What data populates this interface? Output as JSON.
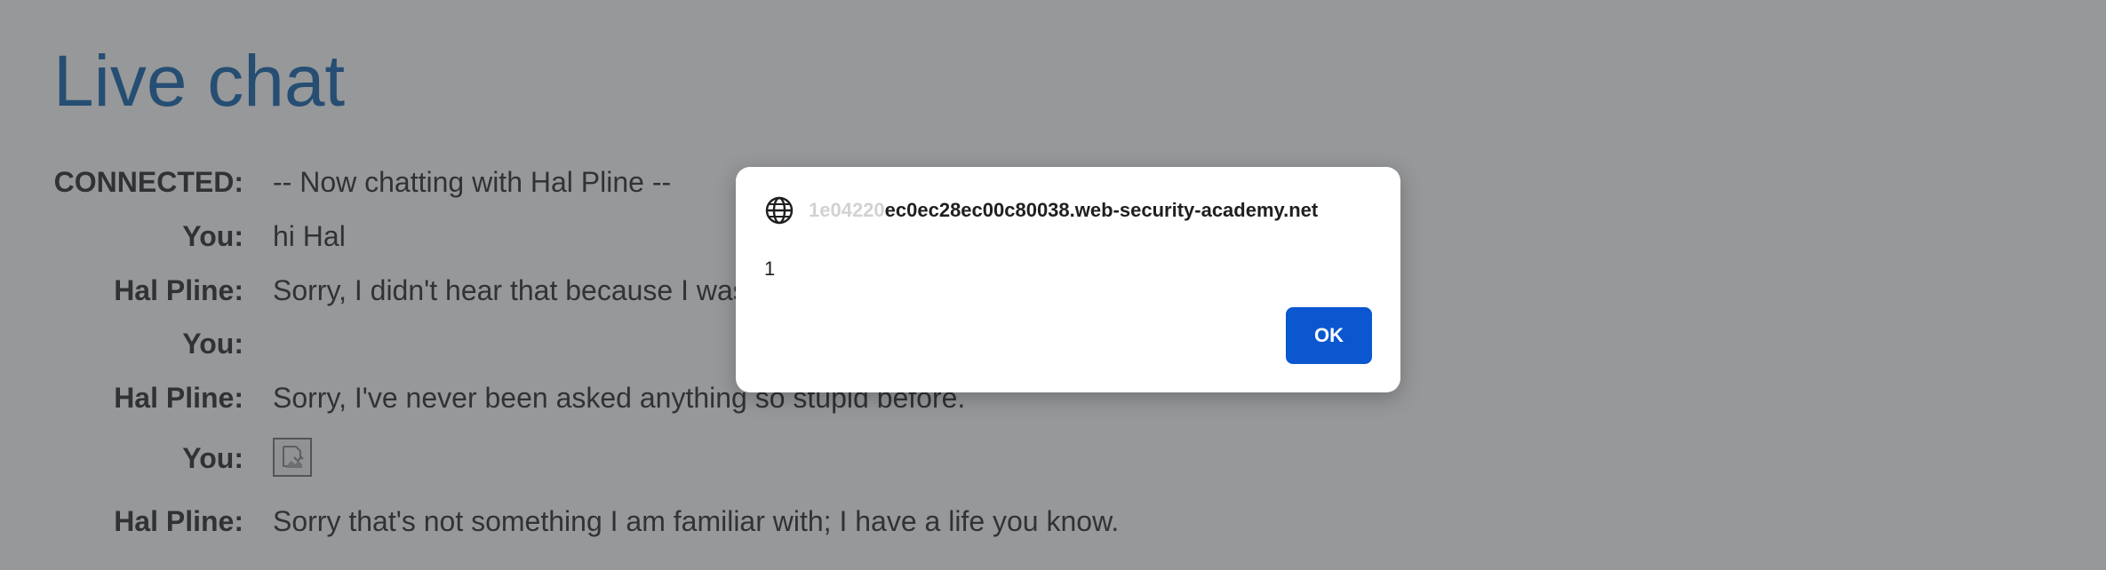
{
  "page": {
    "title": "Live chat"
  },
  "chat": {
    "messages": [
      {
        "sender": "CONNECTED:",
        "text": "-- Now chatting with Hal Pline --"
      },
      {
        "sender": "You:",
        "text": "hi Hal"
      },
      {
        "sender": "Hal Pline:",
        "text": "Sorry, I didn't hear that because I was"
      },
      {
        "sender": "You:",
        "text": ""
      },
      {
        "sender": "Hal Pline:",
        "text": "Sorry, I've never been asked anything so stupid before."
      },
      {
        "sender": "You:",
        "text": "",
        "image": "broken-image-icon"
      },
      {
        "sender": "Hal Pline:",
        "text": "Sorry that's not something I am familiar with; I have a life you know."
      }
    ]
  },
  "alert": {
    "origin_faded": "1e04220",
    "origin_main": "ec0ec28ec00c80038.web-security-academy.net",
    "message": "1",
    "ok_label": "OK",
    "icon": "globe-icon"
  },
  "colors": {
    "title": "#1c6bb0",
    "text": "#333333",
    "ok_button": "#0b57d0",
    "overlay": "rgba(48,49,54,0.5)"
  }
}
